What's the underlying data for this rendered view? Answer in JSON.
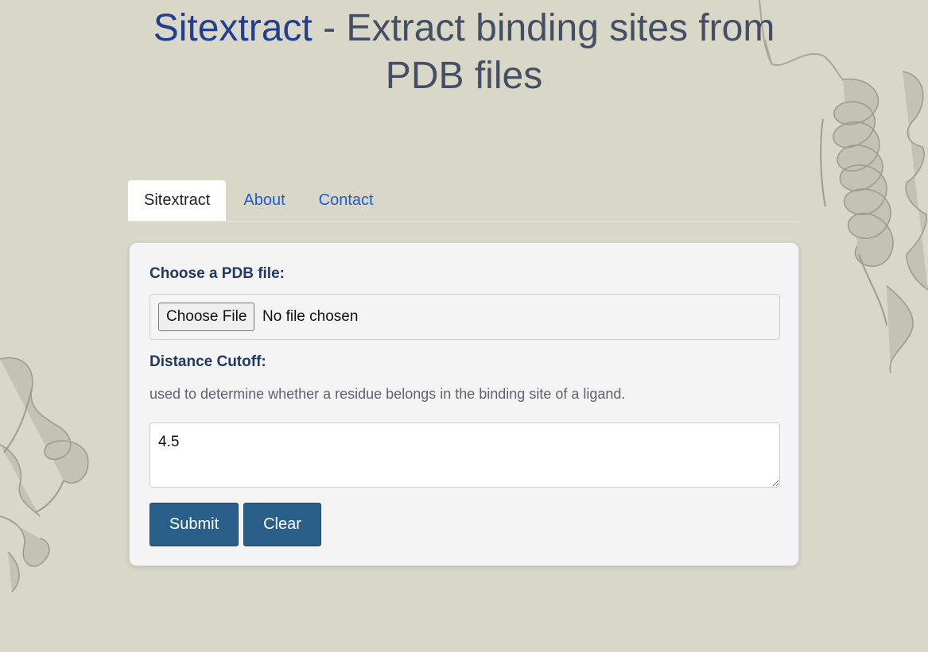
{
  "header": {
    "brand": "Sitextract",
    "title_rest": " - Extract binding sites from PDB files"
  },
  "tabs": [
    {
      "label": "Sitextract",
      "active": true
    },
    {
      "label": "About",
      "active": false
    },
    {
      "label": "Contact",
      "active": false
    }
  ],
  "form": {
    "file_label": "Choose a PDB file:",
    "file_button": "Choose File",
    "file_status": "No file chosen",
    "cutoff_label": "Distance Cutoff:",
    "cutoff_help": "used to determine whether a residue belongs in the binding site of a ligand.",
    "cutoff_value": "4.5",
    "submit_label": "Submit",
    "clear_label": "Clear"
  },
  "colors": {
    "background": "#d9d7c8",
    "brand": "#243e8f",
    "link": "#1f5bd6",
    "button": "#2a5f8a",
    "label": "#213a63"
  },
  "decorations": [
    "protein-ribbon-right",
    "protein-ribbon-left"
  ]
}
